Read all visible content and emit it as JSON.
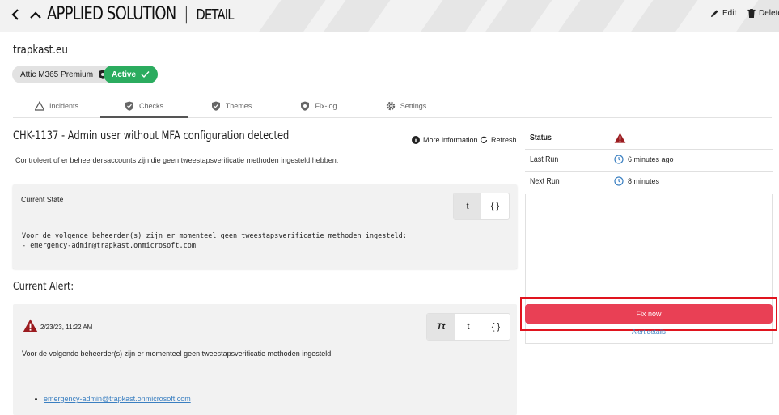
{
  "header": {
    "title": "APPLIED SOLUTION",
    "subtitle": "DETAIL",
    "edit_label": "Edit",
    "delete_label": "Delete"
  },
  "tenant": {
    "domain": "trapkast.eu",
    "license_label": "Attic M365 Premium",
    "status_label": "Active"
  },
  "tabs": [
    {
      "label": "Incidents",
      "icon": "triangle-icon"
    },
    {
      "label": "Checks",
      "icon": "shield-check-icon",
      "active": true
    },
    {
      "label": "Themes",
      "icon": "shield-check-icon"
    },
    {
      "label": "Fix-log",
      "icon": "shield-gear-icon"
    },
    {
      "label": "Settings",
      "icon": "gear-icon"
    }
  ],
  "check": {
    "title": "CHK-1137 - Admin user without MFA configuration detected",
    "more_info_label": "More information",
    "refresh_label": "Refresh",
    "description": "Controleert of er beheerdersaccounts zijn die geen tweestapsverificatie methoden ingesteld hebben."
  },
  "current_state": {
    "title": "Current State",
    "view_text": "t",
    "view_json": "{ }",
    "content": "Voor de volgende beheerder(s) zijn er momenteel geen tweestapsverificatie methoden ingesteld:\n- emergency-admin@trapkast.onmicrosoft.com"
  },
  "current_alert": {
    "section_title": "Current Alert:",
    "timestamp": "2/23/23, 11:22 AM",
    "view_rich": "Tt",
    "view_text": "t",
    "view_json": "{ }",
    "message": "Voor de volgende beheerder(s) zijn er momenteel geen tweestapsverificatie methoden ingesteld:",
    "items": [
      "emergency-admin@trapkast.onmicrosoft.com"
    ]
  },
  "side": {
    "status_label": "Status",
    "last_run_label": "Last Run",
    "last_run_value": "6 minutes ago",
    "next_run_label": "Next Run",
    "next_run_value": "8 minutes",
    "fix_now_label": "Fix now",
    "alert_details_label": "Alert details"
  },
  "colors": {
    "active_green": "#2bac5f",
    "fix_red": "#e94055",
    "warning_dark_red": "#9b1b1f",
    "link_blue": "#3a7fc1",
    "highlight_red": "#e0141e"
  }
}
